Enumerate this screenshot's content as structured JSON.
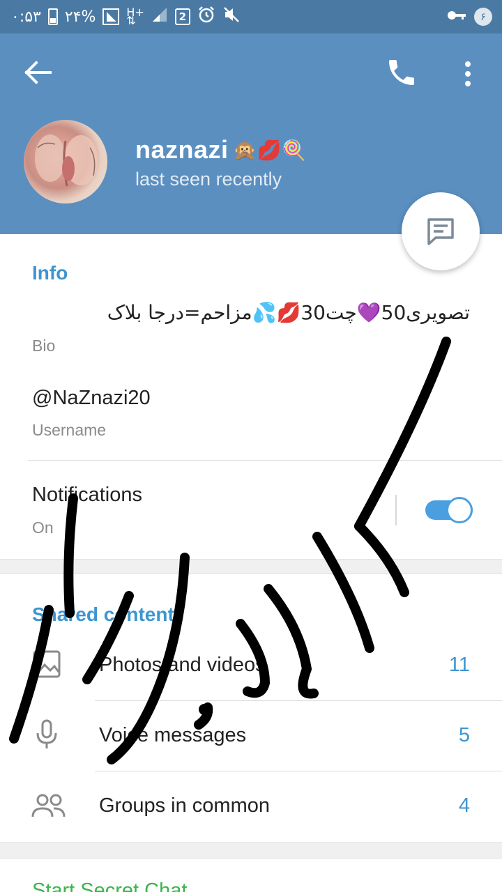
{
  "status_bar": {
    "time": "۰:۵۳",
    "battery": "۲۴%",
    "sim_slot": "2",
    "notification_count": "۶",
    "icons": [
      "battery-icon",
      "signal-icon",
      "data-icon",
      "sim2-icon",
      "alarm-icon",
      "mute-icon",
      "key-icon"
    ]
  },
  "header": {
    "name": "naznazi",
    "name_emojis": "🙊💋🍭",
    "status": "last seen recently",
    "colors": {
      "header_bg": "#5b8fc0",
      "statusbar_bg": "#4a7aa4"
    }
  },
  "info": {
    "title": "Info",
    "bio_value": "تصویری50💜چت30💋💦مزاحم=درجا بلاک",
    "bio_label": "Bio",
    "username_value": "@NaZnazi20",
    "username_label": "Username",
    "notifications_label": "Notifications",
    "notifications_value": "On",
    "notifications_enabled": true
  },
  "shared": {
    "title": "Shared content",
    "items": [
      {
        "label": "Photos and videos",
        "count": "11",
        "icon": "photo-icon"
      },
      {
        "label": "Voice messages",
        "count": "5",
        "icon": "microphone-icon"
      },
      {
        "label": "Groups in common",
        "count": "4",
        "icon": "group-icon"
      }
    ]
  },
  "actions": {
    "secret_chat": "Start Secret Chat"
  },
  "colors": {
    "accent": "#3d95d1",
    "secret": "#3bb44b",
    "toggle": "#4a9fe0"
  }
}
